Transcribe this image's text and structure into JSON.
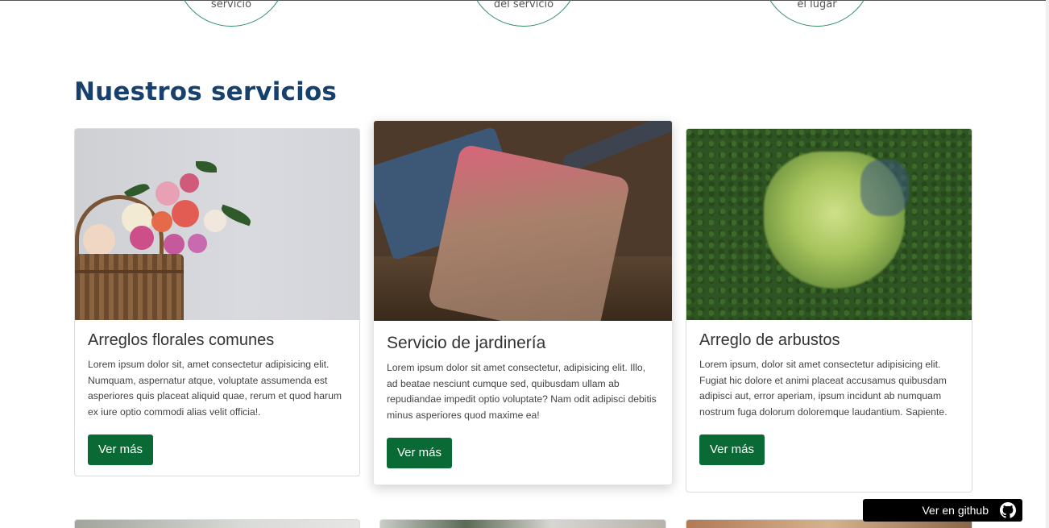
{
  "process_steps": [
    {
      "label": "servicio"
    },
    {
      "label": "del servicio"
    },
    {
      "label": "el lugar"
    }
  ],
  "section": {
    "title": "Nuestros servicios"
  },
  "cards": [
    {
      "title": "Arreglos florales comunes",
      "text": "Lorem ipsum dolor sit, amet consectetur adipisicing elit. Numquam, aspernatur atque, voluptate assumenda est asperiores quis placeat aliquid quae, rerum et quod harum ex iure optio commodi alias velit officia!.",
      "button": "Ver más"
    },
    {
      "title": "Servicio de jardinería",
      "text": "Lorem ipsum dolor sit amet consectetur, adipisicing elit. Illo, ad beatae nesciunt cumque sed, quibusdam ullam ab repudiandae impedit optio voluptate? Nam odit adipisci debitis minus asperiores quod maxime ea!",
      "button": "Ver más"
    },
    {
      "title": "Arreglo de arbustos",
      "text": "Lorem ipsum, dolor sit amet consectetur adipisicing elit. Fugiat hic dolore et animi placeat accusamus quibusdam adipisci aut, error aperiam, ipsum incidunt ab numquam nostrum fuga dolorum doloremque laudantium. Sapiente.",
      "button": "Ver más"
    }
  ],
  "github_badge": {
    "label": "Ver en github",
    "icon": "github-icon"
  },
  "colors": {
    "primary_button": "#0a6a35",
    "title": "#17406d",
    "circle_border": "#2e8b5f"
  }
}
